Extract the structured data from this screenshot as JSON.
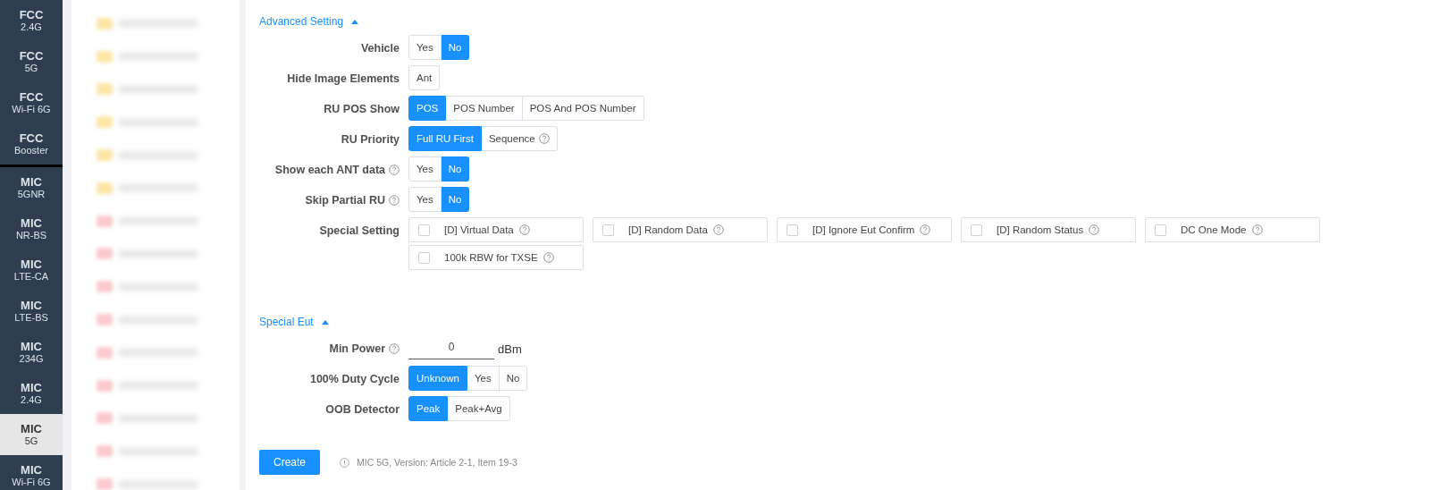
{
  "sidebar": {
    "groups": [
      {
        "items": [
          {
            "title": "FCC",
            "subtitle": "2.4G",
            "selected": false
          },
          {
            "title": "FCC",
            "subtitle": "5G",
            "selected": false
          },
          {
            "title": "FCC",
            "subtitle": "Wi-Fi 6G",
            "selected": false
          },
          {
            "title": "FCC",
            "subtitle": "Booster",
            "selected": false
          }
        ]
      },
      {
        "items": [
          {
            "title": "MIC",
            "subtitle": "5GNR",
            "selected": false
          },
          {
            "title": "MIC",
            "subtitle": "NR-BS",
            "selected": false
          },
          {
            "title": "MIC",
            "subtitle": "LTE-CA",
            "selected": false
          },
          {
            "title": "MIC",
            "subtitle": "LTE-BS",
            "selected": false
          },
          {
            "title": "MIC",
            "subtitle": "234G",
            "selected": false
          },
          {
            "title": "MIC",
            "subtitle": "2.4G",
            "selected": false
          },
          {
            "title": "MIC",
            "subtitle": "5G",
            "selected": true
          },
          {
            "title": "MIC",
            "subtitle": "Wi-Fi 6G",
            "selected": false
          }
        ]
      }
    ]
  },
  "file_list": {
    "items": [
      {
        "color": "#fde5a6"
      },
      {
        "color": "#fde5a6"
      },
      {
        "color": "#fde5a6"
      },
      {
        "color": "#fde5a6"
      },
      {
        "color": "#fde5a6"
      },
      {
        "color": "#fde5a6"
      },
      {
        "color": "#fbc9cc"
      },
      {
        "color": "#fbc9cc"
      },
      {
        "color": "#fbc9cc"
      },
      {
        "color": "#fbc9cc"
      },
      {
        "color": "#fbc9cc"
      },
      {
        "color": "#fbc9cc"
      },
      {
        "color": "#fbc9cc"
      },
      {
        "color": "#fbc9cc"
      },
      {
        "color": "#fbc9cc"
      }
    ]
  },
  "sections": [
    {
      "title": "Advanced Setting",
      "expanded": true,
      "rows": [
        {
          "label": "Vehicle",
          "help": false,
          "kind": "segmented",
          "options": [
            {
              "label": "Yes",
              "help": false,
              "selected": false
            },
            {
              "label": "No",
              "help": false,
              "selected": true
            }
          ]
        },
        {
          "label": "Hide Image Elements",
          "help": false,
          "kind": "segmented",
          "options": [
            {
              "label": "Ant",
              "help": false,
              "selected": false
            }
          ]
        },
        {
          "label": "RU POS Show",
          "help": false,
          "kind": "segmented",
          "options": [
            {
              "label": "POS",
              "help": false,
              "selected": true
            },
            {
              "label": "POS Number",
              "help": false,
              "selected": false
            },
            {
              "label": "POS And POS Number",
              "help": false,
              "selected": false
            }
          ]
        },
        {
          "label": "RU Priority",
          "help": false,
          "kind": "segmented",
          "options": [
            {
              "label": "Full RU First",
              "help": false,
              "selected": true
            },
            {
              "label": "Sequence",
              "help": true,
              "selected": false
            }
          ]
        },
        {
          "label": "Show each ANT data",
          "help": true,
          "kind": "segmented",
          "options": [
            {
              "label": "Yes",
              "help": false,
              "selected": false
            },
            {
              "label": "No",
              "help": false,
              "selected": true
            }
          ]
        },
        {
          "label": "Skip Partial RU",
          "help": true,
          "kind": "segmented",
          "options": [
            {
              "label": "Yes",
              "help": false,
              "selected": false
            },
            {
              "label": "No",
              "help": false,
              "selected": true
            }
          ]
        },
        {
          "label": "Special Setting",
          "help": false,
          "kind": "checkboxes",
          "options": [
            {
              "label": "[D] Virtual Data",
              "help": true,
              "checked": false
            },
            {
              "label": "[D] Random Data",
              "help": true,
              "checked": false
            },
            {
              "label": "[D] Ignore Eut Confirm",
              "help": true,
              "checked": false
            },
            {
              "label": "[D] Random Status",
              "help": true,
              "checked": false
            },
            {
              "label": "DC One Mode",
              "help": true,
              "checked": false
            },
            {
              "label": "100k RBW for TXSE",
              "help": true,
              "checked": false
            }
          ]
        }
      ]
    },
    {
      "title": "Special Eut",
      "expanded": true,
      "rows": [
        {
          "label": "Min Power",
          "help": true,
          "kind": "input",
          "value": "0",
          "unit": "dBm"
        },
        {
          "label": "100% Duty Cycle",
          "help": false,
          "kind": "segmented",
          "options": [
            {
              "label": "Unknown",
              "help": false,
              "selected": true
            },
            {
              "label": "Yes",
              "help": false,
              "selected": false
            },
            {
              "label": "No",
              "help": false,
              "selected": false
            }
          ]
        },
        {
          "label": "OOB Detector",
          "help": false,
          "kind": "segmented",
          "options": [
            {
              "label": "Peak",
              "help": false,
              "selected": true
            },
            {
              "label": "Peak+Avg",
              "help": false,
              "selected": false
            }
          ]
        }
      ]
    }
  ],
  "create_button": "Create",
  "version_note": "MIC 5G, Version: Article 2-1, Item 19-3"
}
